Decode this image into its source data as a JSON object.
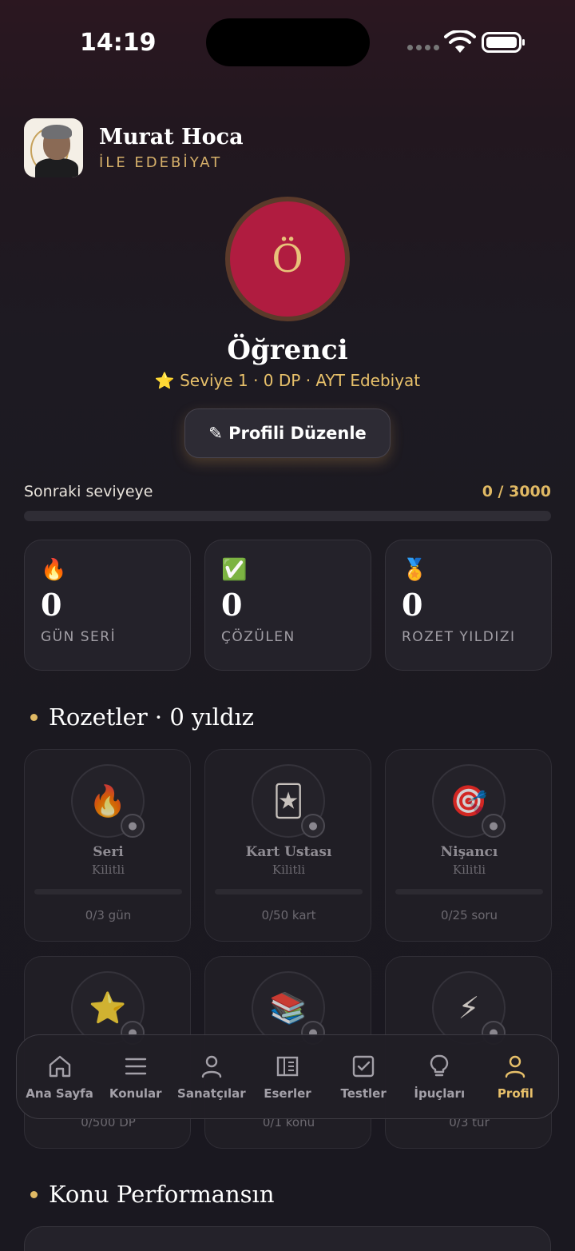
{
  "status": {
    "time": "14:19"
  },
  "header": {
    "title": "Murat Hoca",
    "subtitle": "İLE EDEBİYAT"
  },
  "profile": {
    "initial": "Ö",
    "name": "Öğrenci",
    "meta": "⭐ Seviye 1 · 0 DP · AYT Edebiyat",
    "edit_label": "✎ Profili Düzenle"
  },
  "progress": {
    "label": "Sonraki seviyeye",
    "value": "0 / 3000",
    "fraction": 0.0
  },
  "stats": [
    {
      "icon": "🔥",
      "value": "0",
      "label": "GÜN SERİ"
    },
    {
      "icon": "✅",
      "value": "0",
      "label": "ÇÖZÜLEN"
    },
    {
      "icon": "🏅",
      "value": "0",
      "label": "ROZET YILDIZI"
    }
  ],
  "badges_section": {
    "title": "Rozetler · 0 yıldız"
  },
  "badges": [
    {
      "icon": "🔥",
      "name": "Seri",
      "state": "Kilitli",
      "progress": "0/3 gün"
    },
    {
      "icon": "🃏",
      "name": "Kart Ustası",
      "state": "Kilitli",
      "progress": "0/50 kart"
    },
    {
      "icon": "🎯",
      "name": "Nişancı",
      "state": "Kilitli",
      "progress": "0/25 soru"
    },
    {
      "icon": "⭐",
      "name": "",
      "state": "",
      "progress": "0/500 DP"
    },
    {
      "icon": "📚",
      "name": "",
      "state": "",
      "progress": "0/1 konu"
    },
    {
      "icon": "⚡",
      "name": "",
      "state": "",
      "progress": "0/3 tur"
    }
  ],
  "performance_section": {
    "title": "Konu Performansın"
  },
  "nav": [
    {
      "label": "Ana Sayfa",
      "icon": "home-icon"
    },
    {
      "label": "Konular",
      "icon": "list-icon"
    },
    {
      "label": "Sanatçılar",
      "icon": "person-icon"
    },
    {
      "label": "Eserler",
      "icon": "book-icon"
    },
    {
      "label": "Testler",
      "icon": "checkbox-icon"
    },
    {
      "label": "İpuçları",
      "icon": "lightbulb-icon"
    },
    {
      "label": "Profil",
      "icon": "profile-icon",
      "active": true
    }
  ],
  "colors": {
    "accent": "#e0b964",
    "avatar_bg": "#b01c40",
    "active_nav": "#e7c06a"
  }
}
